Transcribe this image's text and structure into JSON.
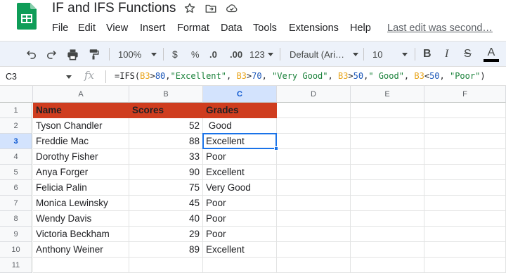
{
  "app": {
    "doc_title": "IF and IFS Functions",
    "menu": [
      "File",
      "Edit",
      "View",
      "Insert",
      "Format",
      "Data",
      "Tools",
      "Extensions",
      "Help"
    ],
    "last_edit": "Last edit was second…"
  },
  "toolbar": {
    "zoom": "100%",
    "currency": "$",
    "percent": "%",
    "decrease_decimal": ".0",
    "increase_decimal": ".00",
    "more_formats": "123",
    "font": "Default (Ari…",
    "font_size": "10",
    "bold": "B",
    "italic": "I",
    "strike": "S",
    "text_color": "A"
  },
  "formula_bar": {
    "cell_ref": "C3",
    "fx": "fx",
    "tokens": [
      {
        "t": "=IFS(",
        "k": "plain"
      },
      {
        "t": "B3",
        "k": "ref"
      },
      {
        "t": ">",
        "k": "plain"
      },
      {
        "t": "80",
        "k": "num"
      },
      {
        "t": ",",
        "k": "plain"
      },
      {
        "t": "\"Excellent\"",
        "k": "str"
      },
      {
        "t": ", ",
        "k": "plain"
      },
      {
        "t": "B3",
        "k": "ref"
      },
      {
        "t": ">",
        "k": "plain"
      },
      {
        "t": "70",
        "k": "num"
      },
      {
        "t": ", ",
        "k": "plain"
      },
      {
        "t": "\"Very Good\"",
        "k": "str"
      },
      {
        "t": ", ",
        "k": "plain"
      },
      {
        "t": "B3",
        "k": "ref"
      },
      {
        "t": ">",
        "k": "plain"
      },
      {
        "t": "50",
        "k": "num"
      },
      {
        "t": ",",
        "k": "plain"
      },
      {
        "t": "\" Good\"",
        "k": "str"
      },
      {
        "t": ", ",
        "k": "plain"
      },
      {
        "t": "B3",
        "k": "ref"
      },
      {
        "t": "<",
        "k": "plain"
      },
      {
        "t": "50",
        "k": "num"
      },
      {
        "t": ", ",
        "k": "plain"
      },
      {
        "t": "\"Poor\"",
        "k": "str"
      },
      {
        "t": ")",
        "k": "plain"
      }
    ]
  },
  "sheet": {
    "columns": [
      "A",
      "B",
      "C",
      "D",
      "E",
      "F"
    ],
    "row_numbers": [
      "1",
      "2",
      "3",
      "4",
      "5",
      "6",
      "7",
      "8",
      "9",
      "10",
      "11"
    ],
    "selected_cell": "C3",
    "header_fill": "#cf3d1f",
    "header": [
      "Name",
      "Scores",
      "Grades"
    ],
    "rows": [
      [
        "Tyson Chandler",
        "52",
        " Good"
      ],
      [
        "Freddie Mac",
        "88",
        "Excellent"
      ],
      [
        "Dorothy Fisher",
        "33",
        "Poor"
      ],
      [
        "Anya Forger",
        "90",
        "Excellent"
      ],
      [
        "Felicia Palin",
        "75",
        "Very Good"
      ],
      [
        "Monica Lewinsky",
        "45",
        "Poor"
      ],
      [
        "Wendy Davis",
        "40",
        "Poor"
      ],
      [
        "Victoria Beckham",
        "29",
        "Poor"
      ],
      [
        "Anthony Weiner",
        "89",
        "Excellent"
      ]
    ]
  }
}
